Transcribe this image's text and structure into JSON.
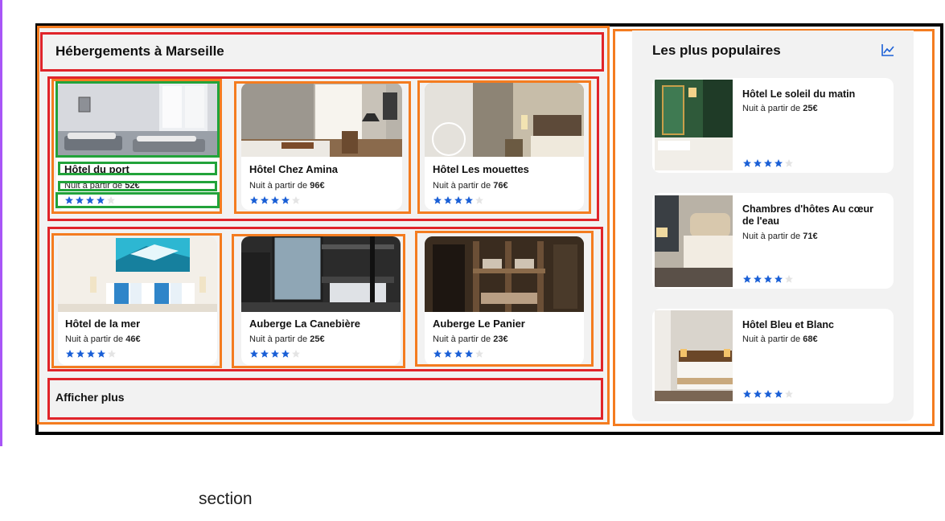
{
  "main": {
    "title": "Hébergements à Marseille",
    "more_label": "Afficher plus",
    "cards": [
      {
        "name": "Hôtel du port",
        "price_prefix": "Nuit à partir de ",
        "price": "52€",
        "rating": 4
      },
      {
        "name": "Hôtel Chez Amina",
        "price_prefix": "Nuit à partir de ",
        "price": "96€",
        "rating": 4
      },
      {
        "name": "Hôtel Les mouettes",
        "price_prefix": "Nuit à partir de ",
        "price": "76€",
        "rating": 4
      },
      {
        "name": "Hôtel de la mer",
        "price_prefix": "Nuit à partir de ",
        "price": "46€",
        "rating": 4
      },
      {
        "name": "Auberge La Canebière",
        "price_prefix": "Nuit à partir de ",
        "price": "25€",
        "rating": 4
      },
      {
        "name": "Auberge Le Panier",
        "price_prefix": "Nuit à partir de ",
        "price": "23€",
        "rating": 4
      }
    ]
  },
  "popular": {
    "title": "Les plus populaires",
    "icon": "trending-chart-icon",
    "items": [
      {
        "name": "Hôtel Le soleil du matin",
        "price_prefix": "Nuit à partir de ",
        "price": "25€",
        "rating": 4
      },
      {
        "name": "Chambres d'hôtes Au cœur de l'eau",
        "price_prefix": "Nuit à partir de ",
        "price": "71€",
        "rating": 4
      },
      {
        "name": "Hôtel Bleu et Blanc",
        "price_prefix": "Nuit à partir de ",
        "price": "68€",
        "rating": 4
      }
    ]
  },
  "caption": "section",
  "colors": {
    "star": "#1a5fd6",
    "star_empty": "#e4e4e4",
    "annotation_red": "#e0242a",
    "annotation_orange": "#f47c20",
    "annotation_green": "#22a33a",
    "accent_purple": "#a855f7"
  }
}
